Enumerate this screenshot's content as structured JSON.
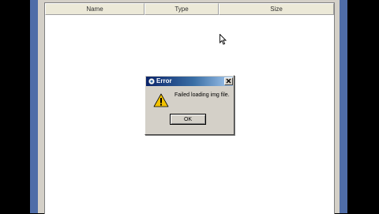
{
  "file_list": {
    "columns": [
      "Name",
      "Type",
      "Size"
    ]
  },
  "dialog": {
    "title": "Error",
    "message": "Failed loading img file.",
    "ok_label": "OK"
  },
  "icons": {
    "title_icon": "app-icon",
    "close_icon": "close-icon",
    "warning_icon": "warning-icon",
    "cursor": "mouse-pointer-icon"
  },
  "colors": {
    "bezel": "#4f6da8",
    "titlebar_start": "#0a246a",
    "titlebar_end": "#a6caf0",
    "window_face": "#d4d0c8",
    "warning_yellow": "#f2c200"
  }
}
